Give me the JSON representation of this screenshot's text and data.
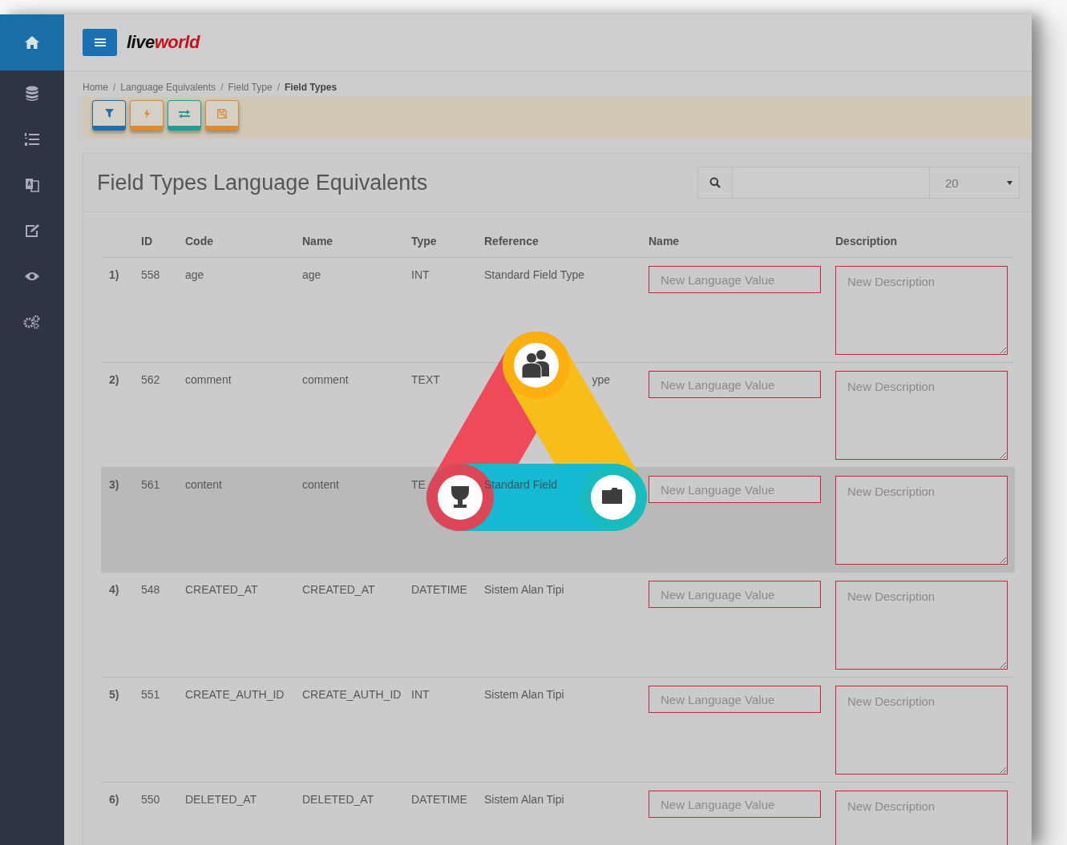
{
  "sidebar": {
    "items": [
      {
        "selected": true
      },
      {
        "selected": false
      },
      {
        "selected": false
      },
      {
        "selected": false
      },
      {
        "selected": false
      },
      {
        "selected": false
      },
      {
        "selected": false
      }
    ]
  },
  "header": {
    "logo": [
      "live",
      "world"
    ]
  },
  "breadcrumb": {
    "separator": "/",
    "items": [
      "Home",
      "Language Equivalents",
      "Field Type",
      "Field Types"
    ]
  },
  "toolbar": {
    "buttons": [
      {
        "kind": "filter",
        "color": "#1f6fae"
      },
      {
        "kind": "bolt",
        "color": "#e08a2c"
      },
      {
        "kind": "exchange",
        "color": "#1e9e94"
      },
      {
        "kind": "save",
        "color": "#e08a2c"
      }
    ]
  },
  "panel": {
    "title": "Field Types Language Equivalents",
    "page_size": "20"
  },
  "table": {
    "columns": [
      "ID",
      "Code",
      "Name",
      "Type",
      "Reference",
      "Name",
      "Description"
    ],
    "rows": [
      {
        "index": "1)",
        "id": "558",
        "code": "age",
        "name": "age",
        "type": "INT",
        "reference": "Standard Field Type",
        "value_placeholder": "New Language Value",
        "description_placeholder": "New Description",
        "selected": false
      },
      {
        "index": "2)",
        "id": "562",
        "code": "comment",
        "name": "comment",
        "type": "TEXT",
        "reference": "ype",
        "kind": "reference-tail-visible",
        "value_placeholder": "New Language Value",
        "description_placeholder": "New Description",
        "selected": false
      },
      {
        "index": "3)",
        "id": "561",
        "code": "content",
        "name": "content",
        "type": "TE",
        "reference": "Standard Field",
        "kind": "reference-through-logo",
        "value_placeholder": "New Language Value",
        "description_placeholder": "New Description",
        "selected": true
      },
      {
        "index": "4)",
        "id": "548",
        "code": "CREATED_AT",
        "name": "CREATED_AT",
        "type": "DATETIME",
        "reference": "Sistem Alan Tipi",
        "value_placeholder": "New Language Value",
        "description_placeholder": "New Description",
        "selected": false
      },
      {
        "index": "5)",
        "id": "551",
        "code": "CREATE_AUTH_ID",
        "name": "CREATE_AUTH_ID",
        "type": "INT",
        "reference": "Sistem Alan Tipi",
        "value_placeholder": "New Language Value",
        "description_placeholder": "New Description",
        "selected": false
      },
      {
        "index": "6)",
        "id": "550",
        "code": "DELETED_AT",
        "name": "DELETED_AT",
        "type": "DATETIME",
        "reference": "Sistem Alan Tipi",
        "value_placeholder": "New Language Value",
        "description_placeholder": "New Description",
        "selected": false
      }
    ]
  }
}
